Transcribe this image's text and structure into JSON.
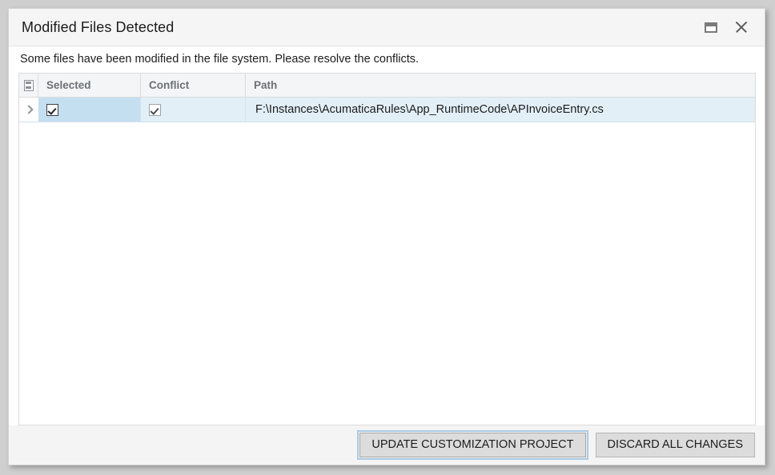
{
  "window": {
    "title": "Modified Files Detected",
    "buttons": [
      {
        "name": "restore-button",
        "icon": "restore-icon",
        "label": "Restore"
      },
      {
        "name": "close-button",
        "icon": "close-icon",
        "label": "Close"
      }
    ]
  },
  "description": "Some files have been modified in the file system. Please resolve the conflicts.",
  "grid": {
    "header_icon": "grid-settings-icon",
    "columns": [
      {
        "key": "selected",
        "label": "Selected"
      },
      {
        "key": "conflict",
        "label": "Conflict"
      },
      {
        "key": "path",
        "label": "Path"
      }
    ],
    "rows": [
      {
        "indicator": "chevron-right-icon",
        "selected": true,
        "conflict": true,
        "path": "F:\\Instances\\AcumaticaRules\\App_RuntimeCode\\APInvoiceEntry.cs"
      }
    ]
  },
  "footer": {
    "update_button": "UPDATE CUSTOMIZATION PROJECT",
    "discard_button": "DISCARD ALL CHANGES"
  },
  "colors": {
    "page_background": "#cfcfcf",
    "dialog_background": "#ffffff",
    "titlebar_background": "#f5f5f5",
    "header_background": "#f4f5f6",
    "header_text": "#6b7177",
    "row_background": "#e3eff7",
    "row_active_cell": "#c4dff0",
    "footer_background": "#f4f4f4",
    "button_background": "#dcdcdc",
    "focus_outline": "#a8cbe4"
  }
}
